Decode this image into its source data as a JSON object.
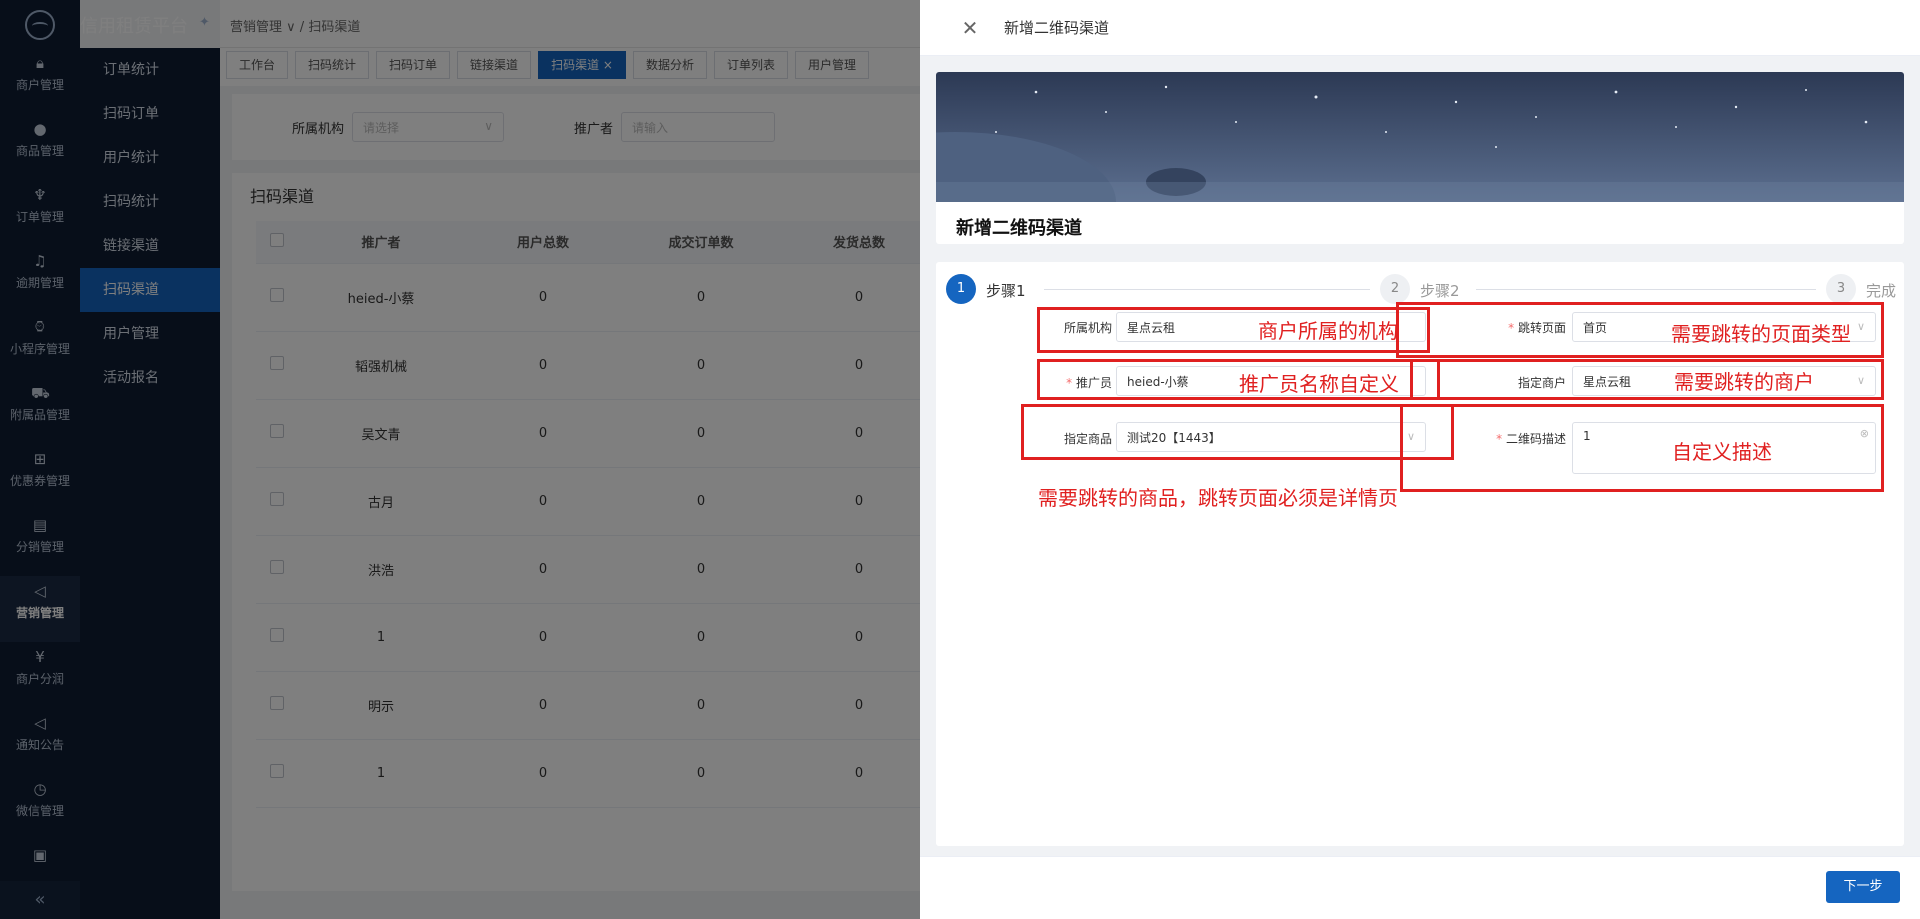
{
  "app": {
    "title": "信用租赁平台",
    "pin_icon": "pin-icon"
  },
  "rail": [
    {
      "label": "商户管理",
      "icon": "lock-icon"
    },
    {
      "label": "商品管理",
      "icon": "apple-icon"
    },
    {
      "label": "订单管理",
      "icon": "trophy-icon"
    },
    {
      "label": "逾期管理",
      "icon": "bell-icon"
    },
    {
      "label": "小程序管理",
      "icon": "watch-icon"
    },
    {
      "label": "附属品管理",
      "icon": "cart-icon"
    },
    {
      "label": "优惠券管理",
      "icon": "gift-icon"
    },
    {
      "label": "分销管理",
      "icon": "chart-icon"
    },
    {
      "label": "营销管理",
      "icon": "megaphone-icon",
      "active": true
    },
    {
      "label": "商户分润",
      "icon": "yen-icon"
    },
    {
      "label": "通知公告",
      "icon": "notice-icon"
    },
    {
      "label": "微信管理",
      "icon": "timer-icon"
    }
  ],
  "submenu": [
    "订单统计",
    "扫码订单",
    "用户统计",
    "扫码统计",
    "链接渠道",
    "扫码渠道",
    "用户管理",
    "活动报名"
  ],
  "submenu_active": "扫码渠道",
  "breadcrumb": {
    "parent": "营销管理",
    "current": "扫码渠道"
  },
  "tabs": [
    {
      "label": "工作台"
    },
    {
      "label": "扫码统计"
    },
    {
      "label": "扫码订单"
    },
    {
      "label": "链接渠道"
    },
    {
      "label": "扫码渠道",
      "active": true,
      "close": "×"
    },
    {
      "label": "数据分析"
    },
    {
      "label": "订单列表"
    },
    {
      "label": "用户管理"
    }
  ],
  "filter": {
    "org_label": "所属机构",
    "org_placeholder": "请选择",
    "promoter_label": "推广者",
    "promoter_placeholder": "请输入"
  },
  "table": {
    "title": "扫码渠道",
    "headers": [
      "推广者",
      "用户总数",
      "成交订单数",
      "发货总数"
    ],
    "rows": [
      [
        "heied-小蔡",
        "0",
        "0",
        "0"
      ],
      [
        "韬强机械",
        "0",
        "0",
        "0"
      ],
      [
        "吴文青",
        "0",
        "0",
        "0"
      ],
      [
        "古月",
        "0",
        "0",
        "0"
      ],
      [
        "洪浩",
        "0",
        "0",
        "0"
      ],
      [
        "1",
        "0",
        "0",
        "0"
      ],
      [
        "明示",
        "0",
        "0",
        "0"
      ],
      [
        "1",
        "0",
        "0",
        "0"
      ]
    ]
  },
  "drawer": {
    "title": "新增二维码渠道",
    "hero_title": "新增二维码渠道",
    "steps": [
      {
        "num": "1",
        "label": "步骤1"
      },
      {
        "num": "2",
        "label": "步骤2"
      },
      {
        "num": "3",
        "label": "完成"
      }
    ],
    "fields": {
      "org": {
        "label": "所属机构",
        "value": "星点云租"
      },
      "jump_page": {
        "label": "跳转页面",
        "value": "首页",
        "required": "*"
      },
      "promoter": {
        "label": "推广员",
        "value": "heied-小蔡",
        "required": "*"
      },
      "merchant": {
        "label": "指定商户",
        "value": "星点云租"
      },
      "product": {
        "label": "指定商品",
        "value": "测试20【1443】"
      },
      "desc": {
        "label": "二维码描述",
        "value": "1",
        "required": "*"
      }
    },
    "next_button": "下一步"
  },
  "annotations": {
    "org": "商户所属的机构",
    "jump": "需要跳转的页面类型",
    "promoter": "推广员名称自定义",
    "merchant": "需要跳转的商户",
    "desc": "自定义描述",
    "product": "需要跳转的商品，跳转页面必须是详情页"
  },
  "colors": {
    "primary": "#1565c0",
    "sidebar": "#0f1d33",
    "annotation": "#e02020"
  }
}
